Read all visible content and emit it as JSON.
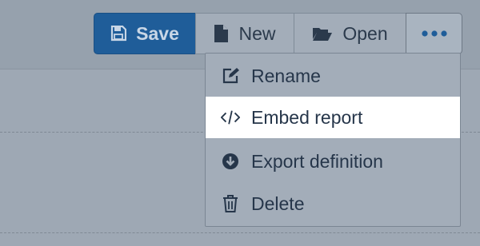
{
  "colors": {
    "accent": "#1f5d99",
    "text": "#26364a",
    "highlight": "#ffffff"
  },
  "toolbar": {
    "save_label": "Save",
    "new_label": "New",
    "open_label": "Open",
    "more_icon": "ellipsis-icon"
  },
  "menu": {
    "items": [
      {
        "label": "Rename",
        "icon": "edit-icon"
      },
      {
        "label": "Embed report",
        "icon": "code-icon",
        "highlighted": true
      },
      {
        "label": "Export definition",
        "icon": "download-circle-icon"
      },
      {
        "label": "Delete",
        "icon": "trash-icon"
      }
    ]
  }
}
